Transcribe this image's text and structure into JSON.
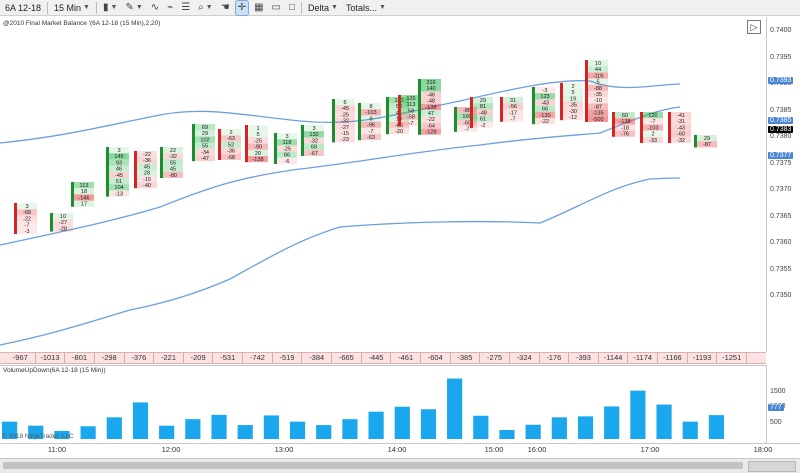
{
  "toolbar": {
    "instrument": "6A 12-18",
    "interval": "15 Min",
    "mode": "Delta",
    "totals": "Totals..."
  },
  "price_panel": {
    "indicator_label": "@2010 Final Market Balance '(6A 12-18 (15 Min),2,20)",
    "y_ticks": [
      "0.7400",
      "0.7395",
      "0.7390",
      "0.7385",
      "0.7380",
      "0.7375",
      "0.7370",
      "0.7365",
      "0.7360",
      "0.7355",
      "0.7350"
    ],
    "band_tags": [
      {
        "label": "0.7393",
        "color": "#4a86d6"
      },
      {
        "label": "0.7385",
        "color": "#4a86d6"
      },
      {
        "label": "0.7383",
        "color": "#000000"
      },
      {
        "label": "0.7377",
        "color": "#4a86d6"
      }
    ]
  },
  "delta_totals": [
    "-967",
    "-1013",
    "-801",
    "-298",
    "-376",
    "-221",
    "-209",
    "-531",
    "-742",
    "-519",
    "-384",
    "-665",
    "-445",
    "-461",
    "-604",
    "-385",
    "-275",
    "-324",
    "-176",
    "-393",
    "-1144",
    "-1174",
    "-1166",
    "-1193",
    "-1251"
  ],
  "volume_panel": {
    "title": "VolumeUpDown(6A 12-18 (15 Min))",
    "y_ticks": [
      "1500",
      "1000",
      "500"
    ],
    "last_tag": "777",
    "bar_color": "#1aa7ee",
    "values": [
      560,
      430,
      260,
      410,
      700,
      1180,
      430,
      640,
      780,
      450,
      760,
      560,
      450,
      640,
      880,
      1040,
      960,
      1950,
      750,
      290,
      460,
      700,
      730,
      1050,
      1560,
      1110,
      560,
      770
    ]
  },
  "time_axis": {
    "labels": [
      "11:00",
      "12:00",
      "13:00",
      "14:00",
      "15:00",
      "16:00",
      "17:00",
      "18:00"
    ]
  },
  "copyright": "© 2018 NinjaTrader, LLC",
  "colors": {
    "up": "#1b8f2e",
    "down": "#d62424",
    "band": "#6d9ee0",
    "delta_bg": "#fbe3e3"
  },
  "footprint": {
    "columns": [
      {
        "dir": "down",
        "cells": [
          {
            "b": "",
            "a": "3"
          },
          {
            "b": "",
            "a": "-68"
          },
          {
            "b": "",
            "a": "-22"
          },
          {
            "b": "",
            "a": "-7"
          },
          {
            "b": "",
            "a": "-3"
          }
        ]
      },
      {
        "dir": "up",
        "cells": [
          {
            "b": "",
            "a": "10"
          },
          {
            "b": "",
            "a": "-27"
          },
          {
            "b": "",
            "a": "-28"
          }
        ]
      },
      {
        "dir": "up",
        "cells": [
          {
            "b": "",
            "a": "113"
          },
          {
            "b": "",
            "a": "18"
          },
          {
            "b": "",
            "a": "-146"
          },
          {
            "b": "",
            "a": "17"
          }
        ]
      },
      {
        "dir": "up",
        "cells": [
          {
            "b": "",
            "a": "3"
          },
          {
            "b": "",
            "a": "145"
          },
          {
            "b": "",
            "a": "93"
          },
          {
            "b": "",
            "a": "46"
          },
          {
            "b": "",
            "a": "-45"
          },
          {
            "b": "",
            "a": "51"
          },
          {
            "b": "",
            "a": "104"
          },
          {
            "b": "",
            "a": "-13"
          }
        ]
      },
      {
        "dir": "down",
        "cells": [
          {
            "b": "",
            "a": "-22"
          },
          {
            "b": "",
            "a": "-36"
          },
          {
            "b": "",
            "a": "45"
          },
          {
            "b": "",
            "a": "28"
          },
          {
            "b": "",
            "a": "-15"
          },
          {
            "b": "",
            "a": "-40"
          }
        ]
      },
      {
        "dir": "up",
        "cells": [
          {
            "b": "",
            "a": "22"
          },
          {
            "b": "",
            "a": "-32"
          },
          {
            "b": "",
            "a": "55"
          },
          {
            "b": "",
            "a": "45"
          },
          {
            "b": "",
            "a": "-80"
          }
        ]
      },
      {
        "dir": "up",
        "cells": [
          {
            "b": "",
            "a": "69"
          },
          {
            "b": "",
            "a": "29"
          },
          {
            "b": "",
            "a": "102"
          },
          {
            "b": "",
            "a": "55"
          },
          {
            "b": "",
            "a": "-34"
          },
          {
            "b": "",
            "a": "-47"
          }
        ]
      },
      {
        "dir": "down",
        "cells": [
          {
            "b": "",
            "a": "2"
          },
          {
            "b": "",
            "a": "-63"
          },
          {
            "b": "",
            "a": "52"
          },
          {
            "b": "",
            "a": "-36"
          },
          {
            "b": "",
            "a": "-68"
          }
        ]
      },
      {
        "dir": "down",
        "cells": [
          {
            "b": "",
            "a": "1"
          },
          {
            "b": "",
            "a": "5"
          },
          {
            "b": "",
            "a": "-25"
          },
          {
            "b": "",
            "a": "-90"
          },
          {
            "b": "",
            "a": "20"
          },
          {
            "b": "",
            "a": "-138"
          }
        ]
      },
      {
        "dir": "up",
        "cells": [
          {
            "b": "",
            "a": "3"
          },
          {
            "b": "",
            "a": "118"
          },
          {
            "b": "",
            "a": "-25"
          },
          {
            "b": "",
            "a": "66"
          },
          {
            "b": "",
            "a": "-6"
          }
        ]
      },
      {
        "dir": "up",
        "cells": [
          {
            "b": "",
            "a": "3"
          },
          {
            "b": "",
            "a": "132"
          },
          {
            "b": "",
            "a": "-32"
          },
          {
            "b": "",
            "a": "68"
          },
          {
            "b": "",
            "a": "-67"
          }
        ]
      },
      {
        "dir": "up",
        "cells": [
          {
            "b": "",
            "a": "6"
          },
          {
            "b": "",
            "a": "-45"
          },
          {
            "b": "",
            "a": "-25"
          },
          {
            "b": "",
            "a": "-32"
          },
          {
            "b": "",
            "a": "-27"
          },
          {
            "b": "",
            "a": "-15"
          },
          {
            "b": "",
            "a": "-23"
          }
        ]
      },
      {
        "dir": "up",
        "cells": [
          {
            "b": "",
            "a": "8"
          },
          {
            "b": "",
            "a": "-103"
          },
          {
            "b": "",
            "a": "9"
          },
          {
            "b": "",
            "a": "-96"
          },
          {
            "b": "",
            "a": "-7"
          },
          {
            "b": "",
            "a": "-63"
          }
        ]
      },
      {
        "dir": "up",
        "cells": [
          {
            "b": "",
            "a": "113"
          },
          {
            "b": "",
            "a": "58"
          },
          {
            "b": "",
            "a": "41"
          },
          {
            "b": "",
            "a": "19"
          },
          {
            "b": "",
            "a": "-65"
          },
          {
            "b": "",
            "a": "-20"
          }
        ]
      },
      {
        "dir": "down",
        "cells": [
          {
            "b": "",
            "a": "126"
          },
          {
            "b": "",
            "a": "113"
          },
          {
            "b": "",
            "a": "58"
          },
          {
            "b": "",
            "a": "-58"
          },
          {
            "b": "",
            "a": "-7"
          }
        ]
      },
      {
        "dir": "up",
        "cells": [
          {
            "b": "",
            "a": "316"
          },
          {
            "b": "",
            "a": "140"
          },
          {
            "b": "",
            "a": "-46"
          },
          {
            "b": "",
            "a": "-48"
          },
          {
            "b": "",
            "a": "-138"
          },
          {
            "b": "",
            "a": "47"
          },
          {
            "b": "",
            "a": "-22"
          },
          {
            "b": "",
            "a": "-64"
          },
          {
            "b": "",
            "a": "-128"
          }
        ]
      },
      {
        "dir": "up",
        "cells": [
          {
            "b": "",
            "a": "-86"
          },
          {
            "b": "",
            "a": "100"
          },
          {
            "b": "",
            "a": "-60"
          },
          {
            "b": "",
            "a": "-7"
          }
        ]
      },
      {
        "dir": "down",
        "cells": [
          {
            "b": "",
            "a": "29"
          },
          {
            "b": "",
            "a": "81"
          },
          {
            "b": "",
            "a": "-48"
          },
          {
            "b": "",
            "a": "61"
          },
          {
            "b": "",
            "a": "-2"
          }
        ]
      },
      {
        "dir": "down",
        "cells": [
          {
            "b": "",
            "a": "31"
          },
          {
            "b": "",
            "a": "-56"
          },
          {
            "b": "",
            "a": "-17"
          },
          {
            "b": "",
            "a": "-7"
          }
        ]
      },
      {
        "dir": "up",
        "cells": [
          {
            "b": "",
            "a": "-3"
          },
          {
            "b": "",
            "a": "123"
          },
          {
            "b": "",
            "a": "-43"
          },
          {
            "b": "",
            "a": "66"
          },
          {
            "b": "",
            "a": "-130"
          },
          {
            "b": "",
            "a": "-22"
          }
        ]
      },
      {
        "dir": "down",
        "cells": [
          {
            "b": "",
            "a": "2"
          },
          {
            "b": "",
            "a": "5"
          },
          {
            "b": "",
            "a": "19"
          },
          {
            "b": "",
            "a": "-35"
          },
          {
            "b": "",
            "a": "-30"
          },
          {
            "b": "",
            "a": "-12"
          }
        ]
      },
      {
        "dir": "down",
        "cells": [
          {
            "b": "",
            "a": "10"
          },
          {
            "b": "",
            "a": "44"
          },
          {
            "b": "",
            "a": "-116"
          },
          {
            "b": "",
            "a": "5"
          },
          {
            "b": "",
            "a": "-88"
          },
          {
            "b": "",
            "a": "-35"
          },
          {
            "b": "",
            "a": "-10"
          },
          {
            "b": "",
            "a": "-87"
          },
          {
            "b": "",
            "a": "-135"
          },
          {
            "b": "",
            "a": "-500"
          }
        ]
      },
      {
        "dir": "down",
        "cells": [
          {
            "b": "",
            "a": "60"
          },
          {
            "b": "",
            "a": "-138"
          },
          {
            "b": "",
            "a": "-18"
          },
          {
            "b": "",
            "a": "-76"
          }
        ]
      },
      {
        "dir": "down",
        "cells": [
          {
            "b": "",
            "a": "120"
          },
          {
            "b": "",
            "a": "-7"
          },
          {
            "b": "",
            "a": "-103"
          },
          {
            "b": "",
            "a": "2"
          },
          {
            "b": "",
            "a": "-33"
          }
        ]
      },
      {
        "dir": "down",
        "cells": [
          {
            "b": "",
            "a": "-41"
          },
          {
            "b": "",
            "a": "-31"
          },
          {
            "b": "",
            "a": "-43"
          },
          {
            "b": "",
            "a": "-60"
          },
          {
            "b": "",
            "a": "-32"
          }
        ]
      },
      {
        "dir": "up",
        "cells": [
          {
            "b": "",
            "a": "29"
          },
          {
            "b": "",
            "a": "-87"
          }
        ]
      }
    ]
  }
}
